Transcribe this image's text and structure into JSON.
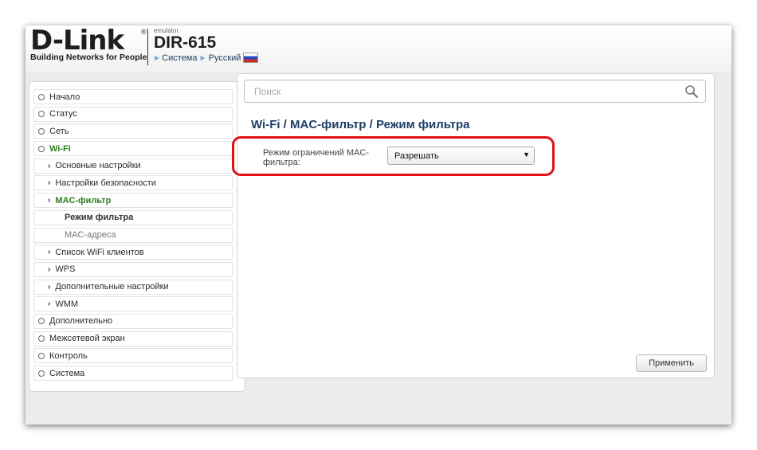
{
  "header": {
    "brand": "D-Link",
    "brand_mark": "®",
    "tagline": "Building Networks for People",
    "emulator": "emulator",
    "model": "DIR-615",
    "breadcrumb_system": "Система",
    "breadcrumb_language": "Русский",
    "flag": "russian-flag-icon"
  },
  "search": {
    "placeholder": "Поиск",
    "icon": "search-icon"
  },
  "page_title": "Wi-Fi /  MAC-фильтр /  Режим фильтра",
  "form": {
    "mode_label": "Режим ограничений MAC-фильтра:",
    "mode_value": "Разрешать"
  },
  "apply_label": "Применить",
  "nav": [
    {
      "label": "Начало",
      "level": 0
    },
    {
      "label": "Статус",
      "level": 0
    },
    {
      "label": "Сеть",
      "level": 0
    },
    {
      "label": "Wi-Fi",
      "level": 0,
      "active": true
    },
    {
      "label": "Основные настройки",
      "level": 1
    },
    {
      "label": "Настройки безопасности",
      "level": 1
    },
    {
      "label": "MAC-фильтр",
      "level": 1,
      "active": true
    },
    {
      "label": "Режим фильтра",
      "level": 2,
      "current": true
    },
    {
      "label": "MAC-адреса",
      "level": 2
    },
    {
      "label": "Список WiFi клиентов",
      "level": 1
    },
    {
      "label": "WPS",
      "level": 1
    },
    {
      "label": "Дополнительные настройки",
      "level": 1
    },
    {
      "label": "WMM",
      "level": 1
    },
    {
      "label": "Дополнительно",
      "level": 0
    },
    {
      "label": "Межсетевой экран",
      "level": 0
    },
    {
      "label": "Контроль",
      "level": 0
    },
    {
      "label": "Система",
      "level": 0
    }
  ],
  "colors": {
    "accent": "#1b3f66",
    "active": "#2e7d1f",
    "highlight": "#e11111"
  }
}
